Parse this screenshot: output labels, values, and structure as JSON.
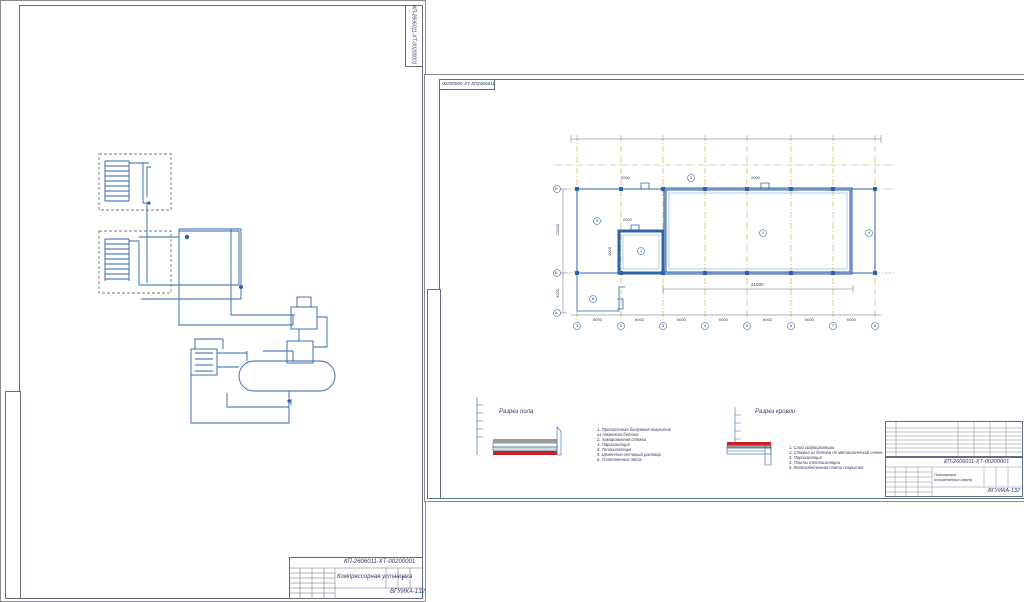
{
  "sheet1": {
    "stamp_code": "КП-2606011-ХТ-00200001",
    "title": "Компрессорная установка",
    "org": "ВГУИКА-132",
    "side_code": "КП-2606011-ХТ-00200001",
    "sheet_number": "1"
  },
  "sheet2": {
    "corner_code": "00200000-ХТ-КП2606011",
    "stamp_code": "КП-2606011-ХТ-00200001",
    "title": "Планировка охлаждаемых камер",
    "org": "ВГУИКА-132",
    "section_floor": "Разрез пола",
    "section_roof": "Разрез кровли",
    "dims": {
      "span": "6000",
      "total": "21000",
      "depth": "12000",
      "wing": "3000",
      "small": "2000",
      "room": "4000"
    },
    "axis_letters": [
      "В",
      "Б",
      "А"
    ],
    "axis_numbers": [
      "1",
      "2",
      "3",
      "4",
      "5",
      "6",
      "7",
      "8"
    ],
    "rooms": [
      "1",
      "2",
      "3",
      "4",
      "5",
      "6"
    ],
    "floor_notes": [
      "1. Пропиточная битумная покрытие",
      "   из тяжелого бетона",
      "2. Армированная стяжка",
      "3. Пароизоляция",
      "4. Теплоизоляция",
      "5. Цементно-песчаный раствор",
      "6. Уплотнённый песок"
    ],
    "roof_notes": [
      "1. Слой гидроизоляции",
      "2. Стяжка из бетона по металлической сетке",
      "3. Пароизоляция",
      "4. Плиты теплоизоляции",
      "5. Железобетонная плита покрытия"
    ]
  }
}
